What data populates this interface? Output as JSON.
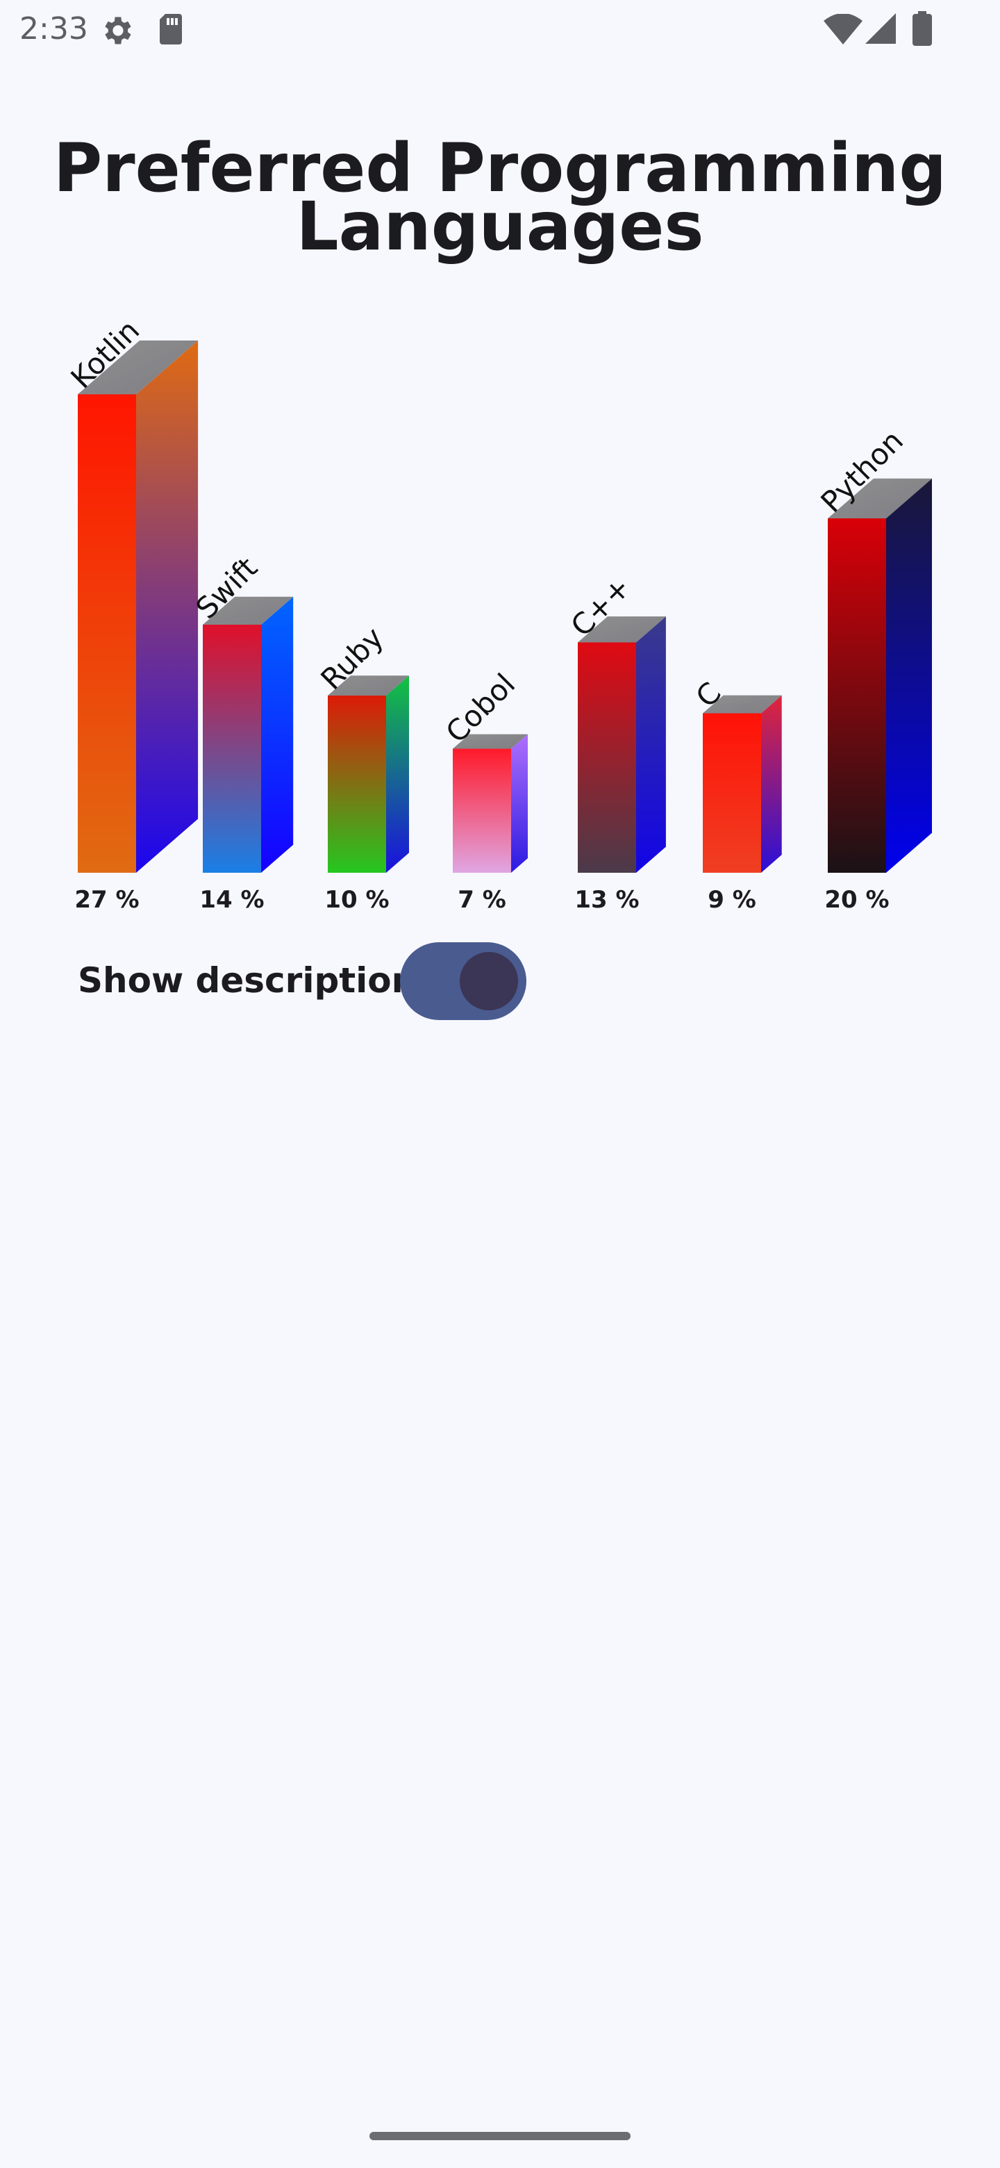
{
  "status_bar": {
    "time": "2:33",
    "icons": [
      "gear-icon",
      "sd-card-icon",
      "wifi-icon",
      "cell-signal-icon",
      "battery-icon"
    ]
  },
  "chart_data": {
    "type": "bar",
    "title": "Preferred Programming Languages",
    "categories": [
      "Kotlin",
      "Swift",
      "Ruby",
      "Cobol",
      "C++",
      "C",
      "Python"
    ],
    "values": [
      27,
      14,
      10,
      7,
      13,
      9,
      20
    ],
    "value_labels": [
      "27 %",
      "14 %",
      "10 %",
      "7 %",
      "13 %",
      "9 %",
      "20 %"
    ],
    "unit": "%",
    "style": "3d-gradient",
    "colors": {
      "Kotlin": {
        "front": [
          "#ff1500",
          "#e06b12"
        ],
        "side": [
          "#e06b12",
          "#1a06ef"
        ]
      },
      "Swift": {
        "front": [
          "#e0102a",
          "#1a7fe6"
        ],
        "side": [
          "#0066ff",
          "#1500ff"
        ]
      },
      "Ruby": {
        "front": [
          "#dd1a08",
          "#25c720"
        ],
        "side": [
          "#14c240",
          "#1a10e0"
        ]
      },
      "Cobol": {
        "front": [
          "#ff1a2a",
          "#dfa6e3"
        ],
        "side": [
          "#ae6ffd",
          "#2b1ae0"
        ]
      },
      "C++": {
        "front": [
          "#e00a12",
          "#4a3a4a"
        ],
        "side": [
          "#3a3a8a",
          "#1204e8"
        ]
      },
      "C": {
        "front": [
          "#ff1208",
          "#ef3f22"
        ],
        "side": [
          "#e0253a",
          "#2a10d8"
        ]
      },
      "Python": {
        "front": [
          "#d90008",
          "#1a1216"
        ],
        "side": [
          "#1a1836",
          "#0000ee"
        ]
      }
    }
  },
  "toggle": {
    "label": "Show description",
    "state": "on"
  }
}
